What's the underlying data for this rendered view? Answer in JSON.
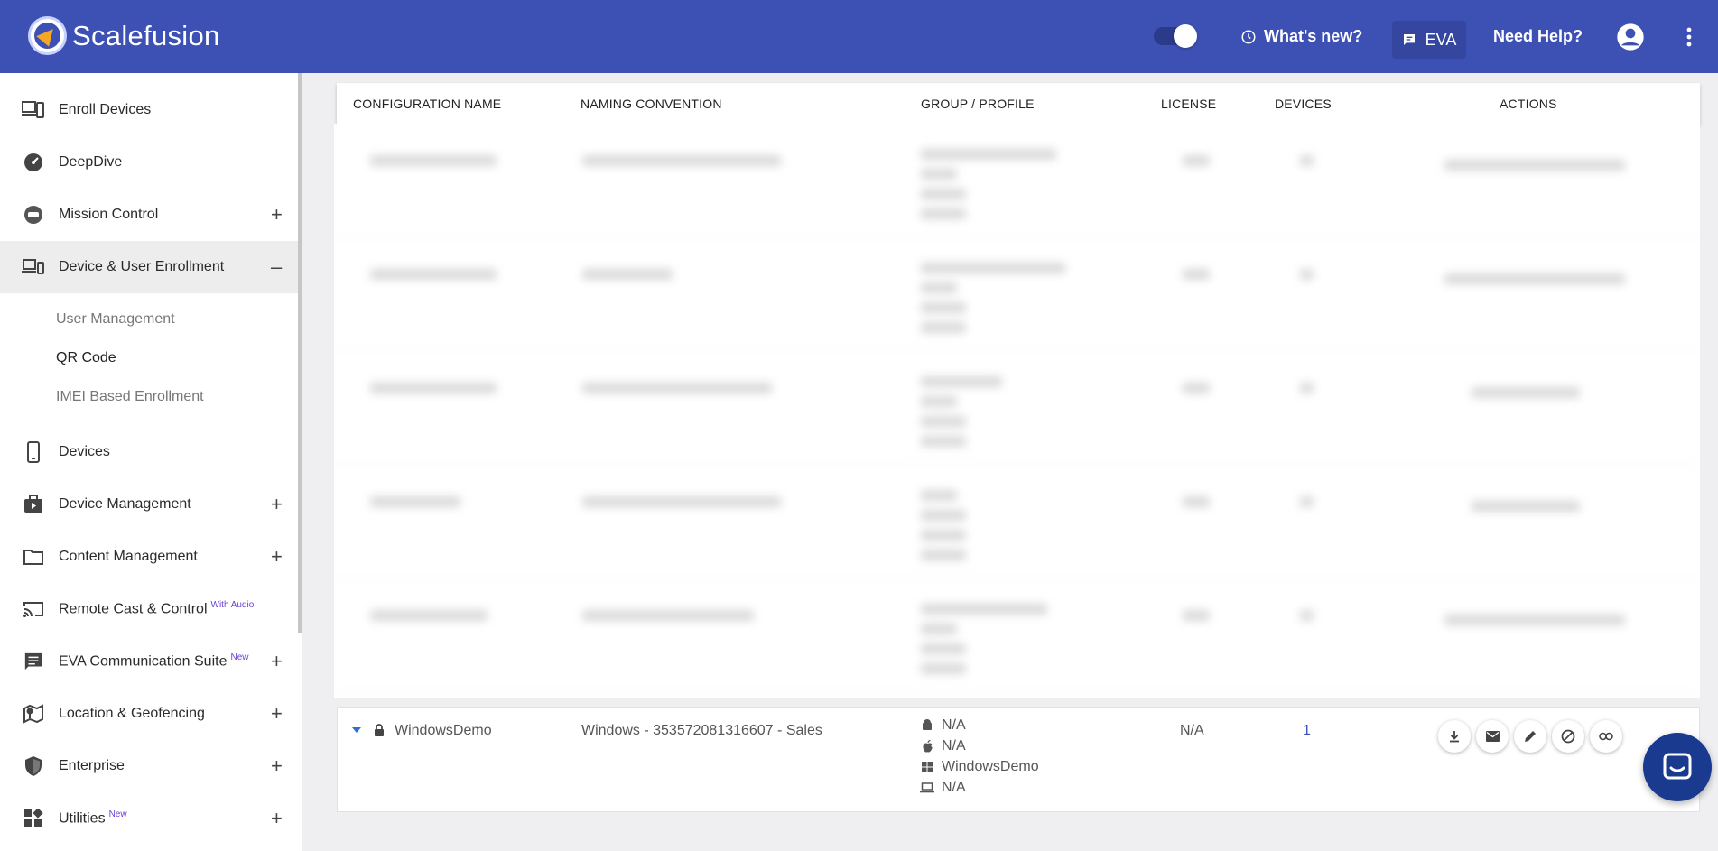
{
  "header": {
    "brand": "Scalefusion",
    "whats_new": "What's new?",
    "eva": "EVA",
    "need_help": "Need Help?"
  },
  "sidebar": {
    "items": [
      {
        "label": "Enroll Devices",
        "icon": "enroll-icon"
      },
      {
        "label": "DeepDive",
        "icon": "speedometer-icon"
      },
      {
        "label": "Mission Control",
        "icon": "mission-control-icon",
        "expandable": "+"
      },
      {
        "label": "Device & User Enrollment",
        "icon": "devices-icon",
        "expandable": "–"
      },
      {
        "label": "Devices",
        "icon": "phone-icon"
      },
      {
        "label": "Device Management",
        "icon": "briefcase-icon",
        "expandable": "+"
      },
      {
        "label": "Content Management",
        "icon": "folder-icon",
        "expandable": "+"
      },
      {
        "label": "Remote Cast & Control",
        "icon": "cast-icon",
        "badge": "With Audio"
      },
      {
        "label": "EVA Communication Suite",
        "icon": "chat-icon",
        "badge": "New",
        "expandable": "+"
      },
      {
        "label": "Location & Geofencing",
        "icon": "map-pin-icon",
        "expandable": "+"
      },
      {
        "label": "Enterprise",
        "icon": "shield-icon",
        "expandable": "+"
      },
      {
        "label": "Utilities",
        "icon": "widgets-icon",
        "badge": "New",
        "expandable": "+"
      }
    ],
    "subitems": [
      "User Management",
      "QR Code",
      "IMEI Based Enrollment"
    ]
  },
  "table": {
    "headers": [
      "CONFIGURATION NAME",
      "NAMING CONVENTION",
      "GROUP / PROFILE",
      "LICENSE",
      "DEVICES",
      "ACTIONS"
    ],
    "row": {
      "name": "WindowsDemo",
      "naming": "Windows - 353572081316607 - Sales",
      "android": "N/A",
      "ios": "N/A",
      "windows": "WindowsDemo",
      "mac": "N/A",
      "license": "N/A",
      "devices": "1"
    }
  },
  "colors": {
    "header_bg": "#3d51b4",
    "accent_badge": "#6b3fd4",
    "link": "#3d51b4",
    "fab": "#1a3a8f"
  }
}
